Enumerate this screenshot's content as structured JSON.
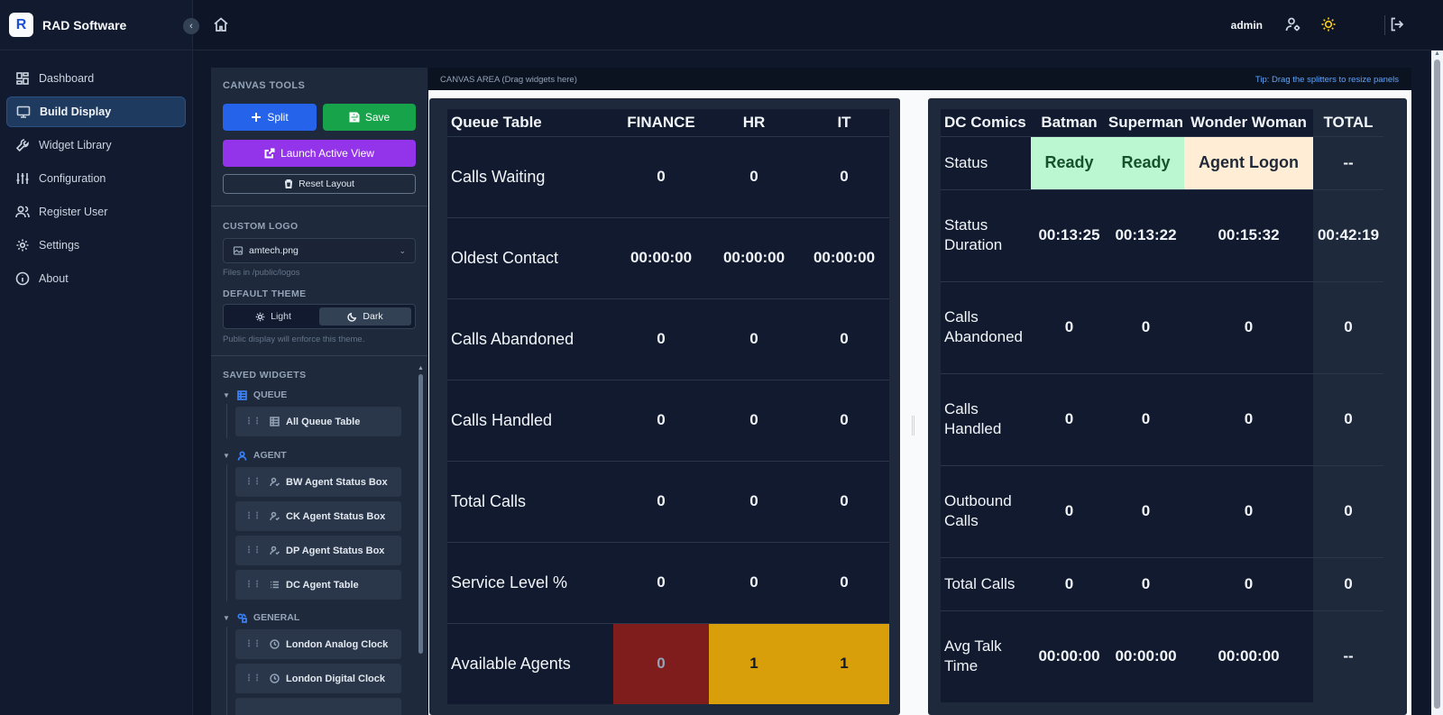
{
  "app": {
    "name": "RAD Software"
  },
  "nav": [
    {
      "label": "Dashboard",
      "icon": "dashboard-icon"
    },
    {
      "label": "Build Display",
      "icon": "monitor-icon",
      "active": true
    },
    {
      "label": "Widget Library",
      "icon": "wrench-icon"
    },
    {
      "label": "Configuration",
      "icon": "sliders-icon"
    },
    {
      "label": "Register User",
      "icon": "users-icon"
    },
    {
      "label": "Settings",
      "icon": "gear-icon"
    },
    {
      "label": "About",
      "icon": "info-icon"
    }
  ],
  "topbar": {
    "user": "admin"
  },
  "tools": {
    "title": "CANVAS TOOLS",
    "split_label": "Split",
    "save_label": "Save",
    "launch_label": "Launch Active View",
    "reset_label": "Reset Layout",
    "custom_logo_title": "CUSTOM LOGO",
    "logo_value": "amtech.png",
    "logo_hint": "Files in /public/logos",
    "theme_title": "DEFAULT THEME",
    "theme_light": "Light",
    "theme_dark": "Dark",
    "theme_selected": "Dark",
    "theme_hint": "Public display will enforce this theme.",
    "saved_title": "SAVED WIDGETS",
    "groups": [
      {
        "label": "QUEUE",
        "items": [
          "All Queue Table"
        ]
      },
      {
        "label": "AGENT",
        "items": [
          "BW Agent Status Box",
          "CK Agent Status Box",
          "DP Agent Status Box",
          "DC Agent Table"
        ]
      },
      {
        "label": "GENERAL",
        "items": [
          "London Analog Clock",
          "London Digital Clock"
        ]
      }
    ]
  },
  "canvas": {
    "area_label": "CANVAS AREA (Drag widgets here)",
    "tip": "Tip: Drag the splitters to resize panels"
  },
  "queue_table": {
    "title": "Queue Table",
    "columns": [
      "FINANCE",
      "HR",
      "IT"
    ],
    "rows": [
      {
        "label": "Calls Waiting",
        "values": [
          "0",
          "0",
          "0"
        ]
      },
      {
        "label": "Oldest Contact",
        "values": [
          "00:00:00",
          "00:00:00",
          "00:00:00"
        ]
      },
      {
        "label": "Calls Abandoned",
        "values": [
          "0",
          "0",
          "0"
        ]
      },
      {
        "label": "Calls Handled",
        "values": [
          "0",
          "0",
          "0"
        ]
      },
      {
        "label": "Total Calls",
        "values": [
          "0",
          "0",
          "0"
        ]
      },
      {
        "label": "Service Level %",
        "values": [
          "0",
          "0",
          "0"
        ]
      },
      {
        "label": "Available Agents",
        "values": [
          "0",
          "1",
          "1"
        ]
      }
    ],
    "colors": {
      "alert_red": "#7f1d1d",
      "warn_amber": "#d99f0a"
    }
  },
  "agent_table": {
    "title": "DC Comics",
    "columns": [
      "Batman",
      "Superman",
      "Wonder Woman",
      "TOTAL"
    ],
    "rows": [
      {
        "label": "Status",
        "values": [
          "Ready",
          "Ready",
          "Agent Logon",
          "--"
        ]
      },
      {
        "label": "Status Duration",
        "values": [
          "00:13:25",
          "00:13:22",
          "00:15:32",
          "00:42:19"
        ]
      },
      {
        "label": "Calls Abandoned",
        "values": [
          "0",
          "0",
          "0",
          "0"
        ]
      },
      {
        "label": "Calls Handled",
        "values": [
          "0",
          "0",
          "0",
          "0"
        ]
      },
      {
        "label": "Outbound Calls",
        "values": [
          "0",
          "0",
          "0",
          "0"
        ]
      },
      {
        "label": "Total Calls",
        "values": [
          "0",
          "0",
          "0",
          "0"
        ]
      },
      {
        "label": "Avg Talk Time",
        "values": [
          "00:00:00",
          "00:00:00",
          "00:00:00",
          "--"
        ]
      }
    ],
    "colors": {
      "ready": "#bbf7d0",
      "logon": "#ffedd5"
    }
  }
}
